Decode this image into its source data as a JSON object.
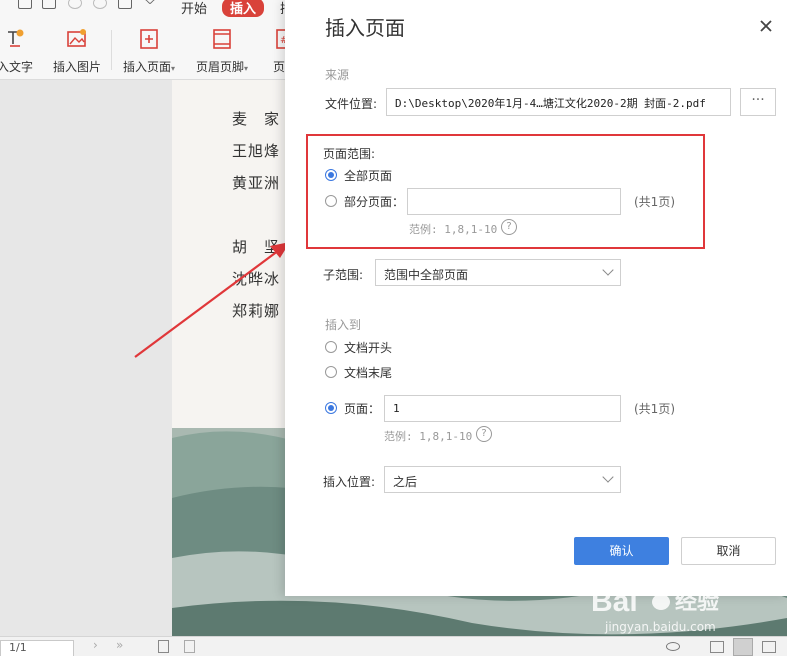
{
  "menu": {
    "tab_start": "开始",
    "tab_insert": "插入",
    "tab_more": "插"
  },
  "toolbar": {
    "insert_text": "入文字",
    "insert_image": "插入图片",
    "insert_page": "插入页面",
    "header_footer": "页眉页脚",
    "page_number": "页码"
  },
  "document": {
    "names": [
      "麦　家",
      "王旭烽",
      "黄亚洲",
      "胡　坚",
      "沈晔冰",
      "郑莉娜"
    ]
  },
  "status": {
    "page_indicator": "1/1"
  },
  "dialog": {
    "title": "插入页面",
    "source_section": "来源",
    "file_label": "文件位置:",
    "file_path": "D:\\Desktop\\2020年1月-4…塘江文化2020-2期 封面-2.pdf",
    "browse_label": "···",
    "range_title": "页面范围:",
    "range_all": "全部页面",
    "range_part": "部分页面：",
    "range_part_value": "",
    "range_total": "(共1页)",
    "range_example": "范例: 1,8,1-10",
    "subrange_label": "子范围:",
    "subrange_value": "范围中全部页面",
    "insert_to_section": "插入到",
    "opt_doc_start": "文档开头",
    "opt_doc_end": "文档末尾",
    "opt_page": "页面：",
    "page_value": "1",
    "page_total": "(共1页)",
    "page_example": "范例: 1,8,1-10",
    "position_label": "插入位置:",
    "position_value": "之后",
    "confirm": "确认",
    "cancel": "取消",
    "help_glyph": "?"
  },
  "watermark": {
    "brand": "Bai",
    "brand_tail": "经验",
    "url": "jingyan.baidu.com"
  },
  "colors": {
    "accent": "#3e80e0",
    "highlight": "#e0373a",
    "insert_tab": "#d9423a"
  }
}
